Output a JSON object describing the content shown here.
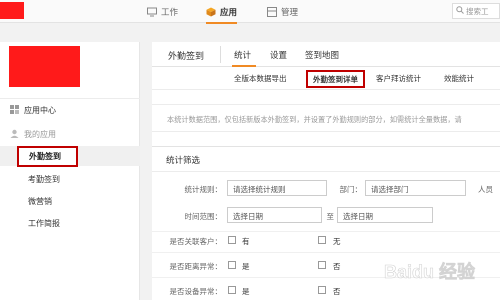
{
  "topbar": {
    "tabs": [
      {
        "label": "工作",
        "icon": "monitor-icon"
      },
      {
        "label": "应用",
        "icon": "cube-icon",
        "active": true
      },
      {
        "label": "管理",
        "icon": "grid-icon"
      }
    ],
    "search_placeholder": "搜索工"
  },
  "sidebar": {
    "app_center": "应用中心",
    "my_apps": "我的应用",
    "items": [
      {
        "label": "外勤签到",
        "active": true
      },
      {
        "label": "考勤签到"
      },
      {
        "label": "微营销"
      },
      {
        "label": "工作简报"
      }
    ]
  },
  "main": {
    "title": "外勤签到",
    "tabs": [
      "统计",
      "设置",
      "签到地图"
    ],
    "subtabs": [
      "全版本数据导出",
      "外勤签到详单",
      "客户拜访统计",
      "效能统计"
    ],
    "notice": "本统计数据范围，仅包括新版本外勤签到，并设置了外勤规则的部分，如需统计全量数据，请",
    "filters": {
      "title": "统计筛选",
      "rule_label": "统计规则：",
      "rule_placeholder": "请选择统计规则",
      "dept_label": "部门：",
      "dept_placeholder": "请选择部门",
      "person_label": "人员",
      "time_label": "时间范围：",
      "date_start": "选择日期",
      "to": "至",
      "date_end": "选择日期",
      "rows": [
        {
          "label": "是否关联客户：",
          "opt1": "有",
          "opt2": "无"
        },
        {
          "label": "是否距离异常：",
          "opt1": "是",
          "opt2": "否"
        },
        {
          "label": "是否设备异常：",
          "opt1": "是",
          "opt2": "否"
        }
      ]
    }
  },
  "watermark": "Baidu 经验",
  "colors": {
    "accent": "#f08a24",
    "highlight_box": "#c00000",
    "redacted": "#ff1a1a"
  }
}
